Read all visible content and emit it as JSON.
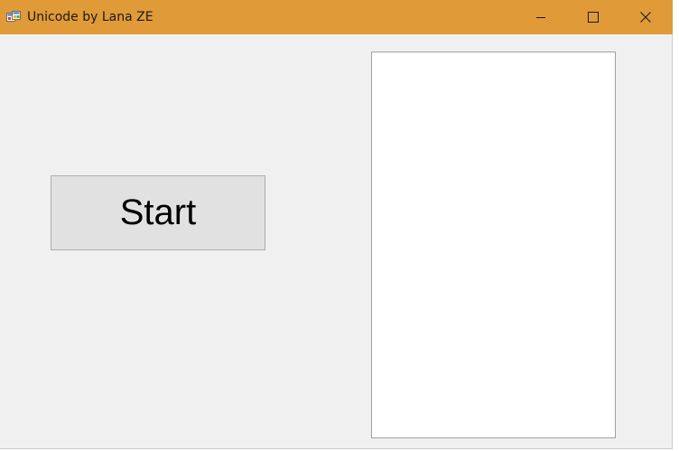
{
  "window": {
    "title": "Unicode by Lana ZE",
    "icon": "app-window-icon",
    "titlebar_color": "#e09a38",
    "background_color": "#f0f0f0",
    "controls": {
      "minimize_icon": "minimize-icon",
      "maximize_icon": "maximize-icon",
      "close_icon": "close-icon"
    }
  },
  "main": {
    "start_button": {
      "label": "Start"
    },
    "output_box": {
      "value": ""
    }
  }
}
